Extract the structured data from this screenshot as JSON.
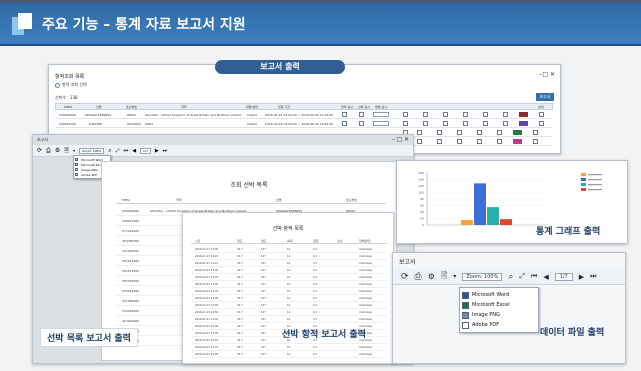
{
  "header": {
    "title": "주요 기능 – 통계 자료 보고서 지원"
  },
  "banner": {
    "label": "보고서 출력"
  },
  "list_panel": {
    "title": "항적조회 목록",
    "option": "항적 조회 선택",
    "count": "선박수 : 138",
    "report_button": "보고서",
    "columns": [
      "MMSI",
      "선명",
      "호출부호",
      "국적",
      "화물/상태",
      "입항 기간",
      "항적 표시",
      "선박 표시",
      "범례 표시",
      "상세"
    ],
    "rows": [
      {
        "mmsi": "239005000",
        "name": "SPYRAN EXPRESS",
        "call": "ZDKI2",
        "flag": "Gibraltar - United Kingdom of Great Britain and Northern Ireland",
        "status": "Classic",
        "period": "2016-02-23 14:05:00 ~ 2016-02-24 14:05:00"
      },
      {
        "mmsi": "249027000",
        "name": "K-WATER",
        "call": "9HA4000",
        "flag": "Malta",
        "status": "Classic",
        "period": "2016-02-23 14:05:00 ~ 2016-02-24 14:05:00"
      }
    ]
  },
  "report_panel": {
    "title": "보고서",
    "zoom": "Zoom: 100%",
    "page": "1/7",
    "page_title": "조회 선박 목록",
    "export_menu": [
      "Microsoft Word",
      "Microsoft Excel",
      "Image PNG",
      "Adobe PDF"
    ],
    "col_heads": [
      "MMSI",
      "국적",
      "선명",
      "호출부호"
    ],
    "rows": [
      [
        "239005000",
        "Gibraltar - United Kingdom of Great Britain and Northern Ireland",
        "SPYRAN EXPRESS",
        "ZDKI2"
      ],
      [
        "249027000",
        "",
        "",
        ""
      ],
      [
        "271019000",
        "Russia",
        "",
        ""
      ],
      [
        "304780000",
        "Antigua",
        "",
        ""
      ],
      [
        "311000397",
        "Bahamas",
        "",
        ""
      ],
      [
        "351673000",
        "Panama",
        "",
        ""
      ],
      [
        "352572000",
        "Panama",
        "",
        ""
      ],
      [
        "355935000",
        "Panama",
        "",
        ""
      ],
      [
        "370513000",
        "Panama",
        "",
        ""
      ],
      [
        "371085000",
        "Panama",
        "",
        ""
      ],
      [
        "372525000",
        "Panama",
        "",
        ""
      ],
      [
        "412001000",
        "China (Pea)",
        "",
        ""
      ],
      [
        "412067000",
        "China (Pea)",
        "",
        ""
      ],
      [
        "412091000",
        "China (Pea)",
        "",
        ""
      ]
    ]
  },
  "track_report": {
    "title": "선박 항적 목록",
    "cols": [
      "시간",
      "위도",
      "경도",
      "속력",
      "침로",
      "선수",
      "항해상태"
    ],
    "rows": [
      [
        "2016.02.23 14:05",
        "34.7",
        "127",
        "10",
        "0.1",
        "",
        "Underway"
      ],
      [
        "2016.02.23 14:10",
        "34.7",
        "127",
        "10",
        "0.1",
        "",
        "Underway"
      ],
      [
        "2016.02.23 14:15",
        "34.7",
        "127",
        "10",
        "0.1",
        "",
        "Underway"
      ],
      [
        "2016.02.23 14:20",
        "34.7",
        "127",
        "10",
        "0.1",
        "",
        "Underway"
      ],
      [
        "2016.02.23 14:25",
        "34.7",
        "127",
        "10",
        "0.1",
        "",
        "Underway"
      ],
      [
        "2016.02.23 14:30",
        "34.7",
        "127",
        "10",
        "0.1",
        "",
        "Underway"
      ],
      [
        "2016.02.23 14:35",
        "34.7",
        "127",
        "10",
        "0.1",
        "",
        "Underway"
      ],
      [
        "2016.02.23 14:40",
        "34.7",
        "127",
        "10",
        "0.1",
        "",
        "Underway"
      ],
      [
        "2016.02.23 14:45",
        "34.7",
        "127",
        "10",
        "0.1",
        "",
        "Underway"
      ],
      [
        "2016.02.23 14:50",
        "34.7",
        "127",
        "10",
        "0.1",
        "",
        "Underway"
      ],
      [
        "2016.02.23 14:55",
        "34.7",
        "127",
        "10",
        "0.1",
        "",
        "Underway"
      ],
      [
        "2016.02.23 15:00",
        "34.7",
        "127",
        "10",
        "0.1",
        "",
        "Underway"
      ],
      [
        "2016.02.23 15:05",
        "34.7",
        "127",
        "10",
        "0.1",
        "",
        "Underway"
      ],
      [
        "2016.02.23 15:10",
        "34.7",
        "127",
        "10",
        "0.1",
        "",
        "Underway"
      ],
      [
        "2016.02.23 15:15",
        "34.7",
        "127",
        "10",
        "0.1",
        "",
        "Underway"
      ],
      [
        "2016.02.23 15:20",
        "34.7",
        "127",
        "10",
        "0.1",
        "",
        "Underway"
      ]
    ]
  },
  "data_file_panel": {
    "title": "보고서",
    "zoom": "Zoom: 100%",
    "page": "1/7",
    "export_menu": [
      "Microsoft Word",
      "Microsoft Excel",
      "Image PNG",
      "Adobe PDF"
    ]
  },
  "captions": {
    "list_report": "선박 목록 보고서 출력",
    "track_report": "선박 항적 보고서 출력",
    "graph": "통계 그래프 출력",
    "data_file": "데이터 파일 출력"
  },
  "chart_data": {
    "type": "bar",
    "title": "",
    "categories": [
      "A",
      "B",
      "C",
      "D"
    ],
    "series": [
      {
        "values": [
          15,
          128,
          55,
          18
        ],
        "color_list": [
          "#f2a33a",
          "#3a6fd8",
          "#2bb0a8",
          "#e0482e"
        ]
      }
    ],
    "ylim": [
      0,
      160
    ],
    "yticks": [
      0,
      20,
      40,
      60,
      80,
      100,
      120,
      140,
      160
    ],
    "legend_items": 4
  },
  "colors": {
    "header": "#2f6aa6",
    "banner": "#2f5f93",
    "caption": "#1f3f6a",
    "accent": "#3d7fbf"
  }
}
